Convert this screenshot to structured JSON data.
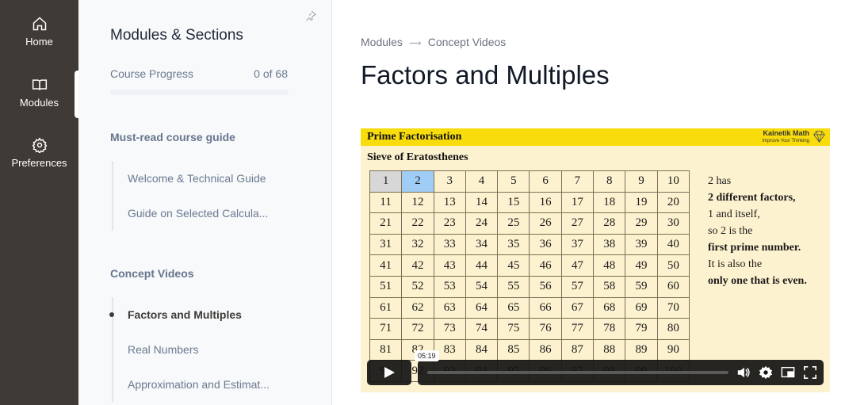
{
  "rail": {
    "items": [
      {
        "label": "Home",
        "icon": "home-icon"
      },
      {
        "label": "Modules",
        "icon": "book-icon",
        "active": true
      },
      {
        "label": "Preferences",
        "icon": "gear-icon"
      }
    ]
  },
  "sidebar": {
    "title": "Modules & Sections",
    "progress": {
      "label": "Course Progress",
      "value_text": "0 of 68",
      "completed": 0,
      "total": 68
    },
    "sections": [
      {
        "title": "Must-read course guide",
        "items": [
          "Welcome & Technical Guide",
          "Guide on Selected Calcula..."
        ]
      },
      {
        "title": "Concept Videos",
        "items": [
          "Factors and Multiples",
          "Real Numbers",
          "Approximation and Estimat..."
        ],
        "active_index": 0
      }
    ]
  },
  "main": {
    "breadcrumb": [
      "Modules",
      "Concept Videos"
    ],
    "breadcrumb_sep": "⟿",
    "title": "Factors and Multiples"
  },
  "video": {
    "header_title": "Prime Factorisation",
    "brand": "Kainetik Math",
    "brand_tagline": "Improve Your Thinking",
    "subtitle": "Sieve of Eratosthenes",
    "grid_rows": [
      [
        "1",
        "2",
        "3",
        "4",
        "5",
        "6",
        "7",
        "8",
        "9",
        "10"
      ],
      [
        "11",
        "12",
        "13",
        "14",
        "15",
        "16",
        "17",
        "18",
        "19",
        "20"
      ],
      [
        "21",
        "22",
        "23",
        "24",
        "25",
        "26",
        "27",
        "28",
        "29",
        "30"
      ],
      [
        "31",
        "32",
        "33",
        "34",
        "35",
        "36",
        "37",
        "38",
        "39",
        "40"
      ],
      [
        "41",
        "42",
        "43",
        "44",
        "45",
        "46",
        "47",
        "48",
        "49",
        "50"
      ],
      [
        "51",
        "52",
        "53",
        "54",
        "55",
        "56",
        "57",
        "58",
        "59",
        "60"
      ],
      [
        "61",
        "62",
        "63",
        "64",
        "65",
        "66",
        "67",
        "68",
        "69",
        "70"
      ],
      [
        "71",
        "72",
        "73",
        "74",
        "75",
        "76",
        "77",
        "78",
        "79",
        "80"
      ],
      [
        "81",
        "82",
        "83",
        "84",
        "85",
        "86",
        "87",
        "88",
        "89",
        "90"
      ],
      [
        "91",
        "92",
        "93",
        "94",
        "95",
        "96",
        "97",
        "98",
        "99",
        "100"
      ]
    ],
    "explanation": [
      {
        "text": "2 has",
        "bold": false
      },
      {
        "text": "2 different factors,",
        "bold": true
      },
      {
        "text": "1 and itself,",
        "bold": false
      },
      {
        "text": "so 2 is the",
        "bold": false
      },
      {
        "text": "first prime number.",
        "bold": true
      },
      {
        "text": "It is also the",
        "bold": false
      },
      {
        "text": "only one that is even.",
        "bold": true
      }
    ],
    "hover_time": "05:19",
    "controls": [
      "play-icon",
      "volume-icon",
      "settings-icon",
      "pip-icon",
      "fullscreen-icon"
    ]
  }
}
